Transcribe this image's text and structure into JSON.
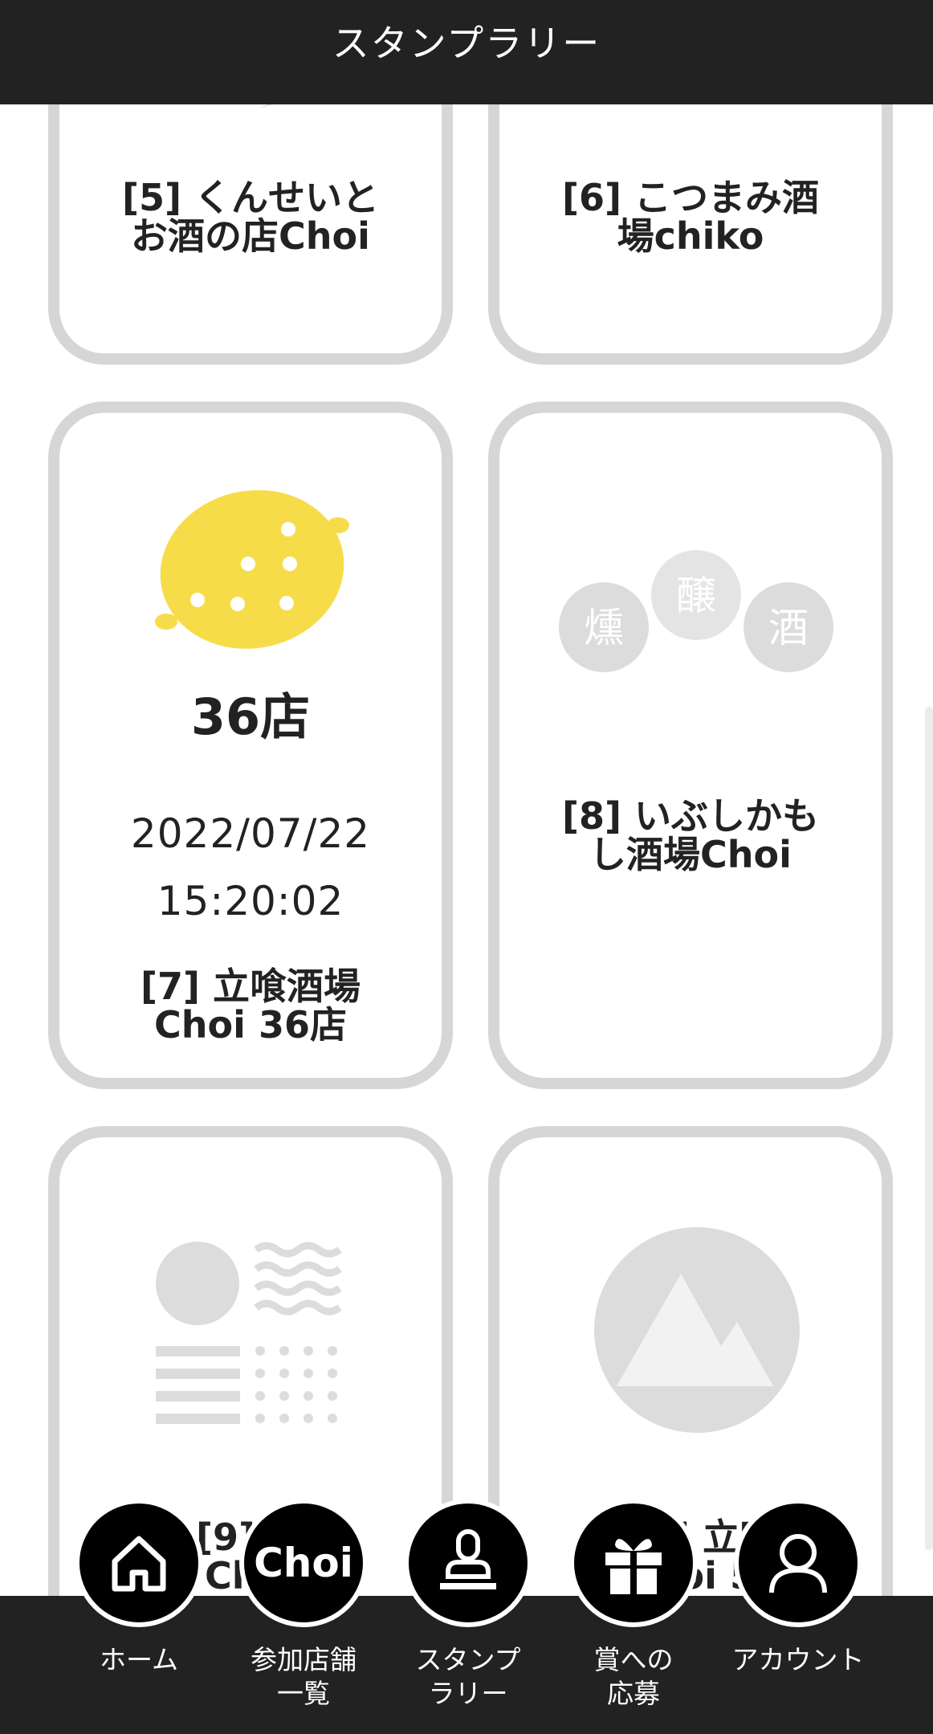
{
  "header": {
    "title": "スタンプラリー"
  },
  "cards": [
    {
      "name_line1": "[5] くんせいと",
      "name_line2": "お酒の店Choi",
      "stamped": false,
      "icon": "smoke-swirl-icon"
    },
    {
      "name_line1": "[6] こつまみ酒",
      "name_line2": "場chiko",
      "stamped": false,
      "icon": "sake-cup-icon"
    },
    {
      "name_line1": "[7] 立喰酒場",
      "name_line2": "Choi 36店",
      "stamped": true,
      "icon": "lemon-icon",
      "stamp_text": "36店",
      "date": "2022/07/22",
      "time": "15:20:02"
    },
    {
      "name_line1": "[8] いぶしかも",
      "name_line2": "し酒場Choi",
      "stamped": false,
      "icon": "kun-jou-sake-circles-icon",
      "logo_chars": [
        "燻",
        "醸",
        "酒"
      ]
    },
    {
      "name_line1": "[9] 立",
      "name_line2": "Choi",
      "stamped": false,
      "icon": "pattern-circle-waves-icon"
    },
    {
      "name_line1": "[10] 立喰",
      "name_line2": "Choi 5",
      "stamped": false,
      "icon": "mountain-icon"
    }
  ],
  "bottom_nav": [
    {
      "label": "ホーム",
      "icon": "home-icon"
    },
    {
      "label": "参加店舗\n一覧",
      "icon": "choi-logo-icon",
      "logo_text": "Choi"
    },
    {
      "label": "スタンプ\nラリー",
      "icon": "stamp-icon"
    },
    {
      "label": "賞への\n応募",
      "icon": "gift-icon"
    },
    {
      "label": "アカウント",
      "icon": "person-icon"
    }
  ],
  "colors": {
    "header_bg": "#222222",
    "card_border": "#d6d6d6",
    "lemon": "#f7dc4a",
    "placeholder_gray": "#dcdcdc"
  }
}
